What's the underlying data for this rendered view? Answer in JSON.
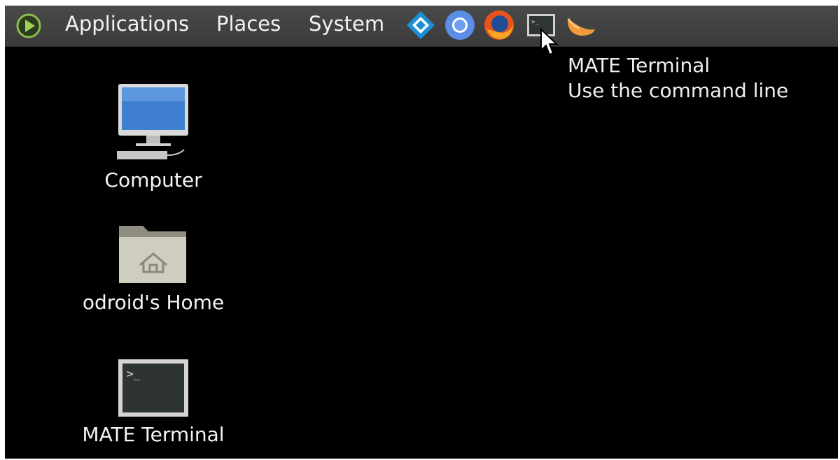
{
  "panel": {
    "menu": {
      "applications": "Applications",
      "places": "Places",
      "system": "System"
    },
    "launchers": [
      "kodi-icon",
      "chromium-icon",
      "firefox-icon",
      "terminal-icon",
      "clementine-icon"
    ]
  },
  "tooltip": {
    "title": "MATE Terminal",
    "description": "Use the command line"
  },
  "desktop": {
    "icons": [
      {
        "label": "Computer",
        "icon": "computer-icon"
      },
      {
        "label": "odroid's Home",
        "icon": "home-folder-icon"
      },
      {
        "label": "MATE Terminal",
        "icon": "terminal-icon"
      }
    ]
  },
  "colors": {
    "panel": "#3f3f3f",
    "desktop": "#000000",
    "text": "#f2f2f2",
    "accent_green": "#7ab648"
  }
}
